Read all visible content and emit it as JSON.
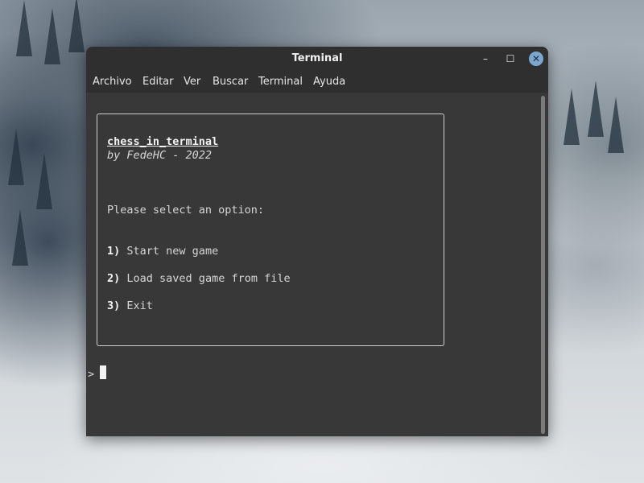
{
  "window": {
    "title": "Terminal",
    "controls": {
      "minimize": "–",
      "maximize": "☐",
      "close": "✕"
    }
  },
  "menu": {
    "items": [
      "Archivo",
      "Editar",
      "Ver",
      "Buscar",
      "Terminal",
      "Ayuda"
    ]
  },
  "terminal": {
    "app_title": "chess_in_terminal",
    "author_line": "by FedeHC - 2022",
    "prompt_text": "Please select an option:",
    "options": [
      {
        "number": "1)",
        "label": "Start new game"
      },
      {
        "number": "2)",
        "label": "Load saved game from file"
      },
      {
        "number": "3)",
        "label": "Exit"
      }
    ],
    "input_prompt": ">"
  }
}
